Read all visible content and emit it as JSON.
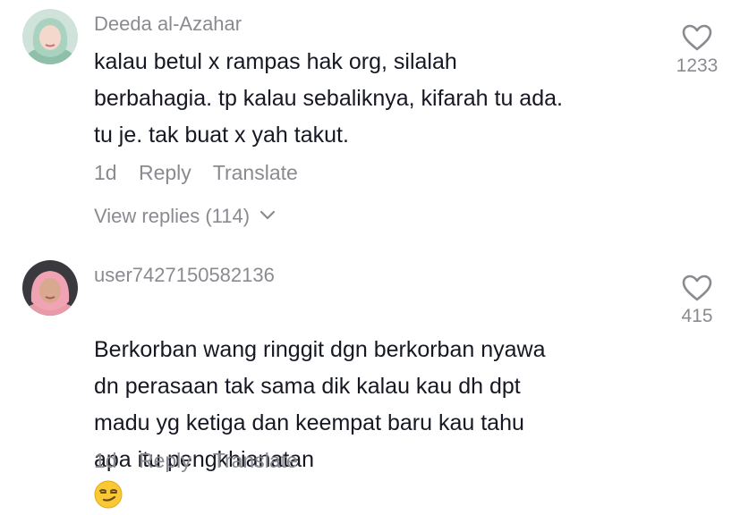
{
  "comments": [
    {
      "username": "Deeda al-Azahar",
      "text": "kalau betul x rampas hak org, silalah\nberbahagia. tp kalau sebaliknya, kifarah tu ada.\ntu je. tak buat x yah takut.",
      "age": "1d",
      "reply_label": "Reply",
      "translate_label": "Translate",
      "like_count": "1233",
      "view_replies": "View replies (114)"
    },
    {
      "username": "user7427150582136",
      "text": "Berkorban wang ringgit dgn berkorban nyawa\ndn perasaan tak sama dik kalau kau dh dpt\nmadu yg ketiga dan keempat baru kau tahu\napa itu pengkhianatan",
      "emoji": "smirking-face",
      "age": "1d",
      "reply_label": "Reply",
      "translate_label": "Translate",
      "like_count": "415"
    }
  ],
  "colors": {
    "primary_text": "#161823",
    "secondary_text": "#8a8b91",
    "background": "#ffffff"
  }
}
